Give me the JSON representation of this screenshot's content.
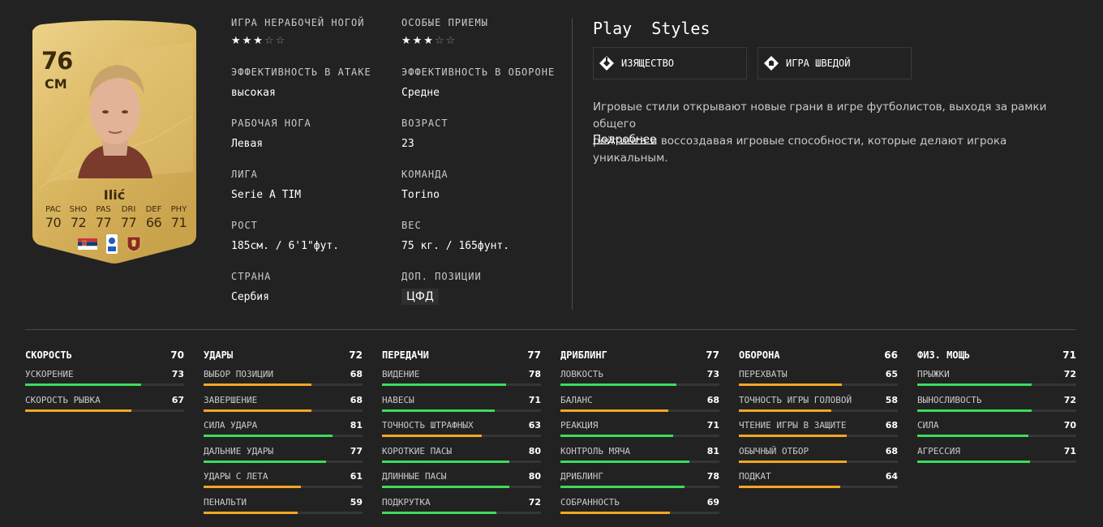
{
  "card": {
    "rating": "76",
    "position": "CM",
    "name": "Ilić",
    "stats": [
      {
        "label": "PAC",
        "value": "70"
      },
      {
        "label": "SHO",
        "value": "72"
      },
      {
        "label": "PAS",
        "value": "77"
      },
      {
        "label": "DRI",
        "value": "77"
      },
      {
        "label": "DEF",
        "value": "66"
      },
      {
        "label": "PHY",
        "value": "71"
      }
    ]
  },
  "info": {
    "weak_foot": {
      "label": "ИГРА НЕРАБОЧЕЙ НОГОЙ",
      "stars": 3
    },
    "skill_moves": {
      "label": "ОСОБЫЕ ПРИЕМЫ",
      "stars": 3
    },
    "attack_wr": {
      "label": "ЭФФЕКТИВНОСТЬ В АТАКЕ",
      "value": "высокая"
    },
    "defense_wr": {
      "label": "ЭФФЕКТИВНОСТЬ В ОБОРОНЕ",
      "value": "Средне"
    },
    "foot": {
      "label": "РАБОЧАЯ НОГА",
      "value": "Левая"
    },
    "age": {
      "label": "ВОЗРАСТ",
      "value": "23"
    },
    "league": {
      "label": "ЛИГА",
      "value": "Serie A TIM"
    },
    "team": {
      "label": "КОМАНДА",
      "value": "Torino"
    },
    "height": {
      "label": "РОСТ",
      "value": "185см. / 6'1\"фут."
    },
    "weight": {
      "label": "ВЕС",
      "value": "75 кг. / 165фунт."
    },
    "country": {
      "label": "СТРАНА",
      "value": "Сербия"
    },
    "alt_pos": {
      "label": "ДОП. ПОЗИЦИИ",
      "value": "ЦФД"
    }
  },
  "playstyles": {
    "title": "Play  Styles",
    "items": [
      "ИЗЯЩЕСТВО",
      "ИГРА ШВЕДОЙ"
    ],
    "description_line1": "Игровые стили открывают новые грани в игре футболистов, выходя за рамки общего",
    "description_line2": "рейтинга и воссоздавая игровые способности, которые делают игрока уникальным.",
    "more": "Подробнее"
  },
  "colors": {
    "good": "#3ddc5b",
    "mid": "#f5a623",
    "accent_gold": "#e0c068"
  },
  "groups": [
    {
      "title": "СКОРОСТЬ",
      "value": "70",
      "attrs": [
        {
          "name": "УСКОРЕНИЕ",
          "value": 73
        },
        {
          "name": "СКОРОСТЬ РЫВКА",
          "value": 67
        }
      ]
    },
    {
      "title": "УДАРЫ",
      "value": "72",
      "attrs": [
        {
          "name": "ВЫБОР ПОЗИЦИИ",
          "value": 68
        },
        {
          "name": "ЗАВЕРШЕНИЕ",
          "value": 68
        },
        {
          "name": "СИЛА УДАРА",
          "value": 81
        },
        {
          "name": "ДАЛЬНИЕ УДАРЫ",
          "value": 77
        },
        {
          "name": "УДАРЫ С ЛЕТА",
          "value": 61
        },
        {
          "name": "ПЕНАЛЬТИ",
          "value": 59
        }
      ]
    },
    {
      "title": "ПЕРЕДАЧИ",
      "value": "77",
      "attrs": [
        {
          "name": "ВИДЕНИЕ",
          "value": 78
        },
        {
          "name": "НАВЕСЫ",
          "value": 71
        },
        {
          "name": "ТОЧНОСТЬ ШТРАФНЫХ",
          "value": 63
        },
        {
          "name": "КОРОТКИЕ ПАСЫ",
          "value": 80
        },
        {
          "name": "ДЛИННЫЕ ПАСЫ",
          "value": 80
        },
        {
          "name": "ПОДКРУТКА",
          "value": 72
        }
      ]
    },
    {
      "title": "ДРИБЛИНГ",
      "value": "77",
      "attrs": [
        {
          "name": "ЛОВКОСТЬ",
          "value": 73
        },
        {
          "name": "БАЛАНС",
          "value": 68
        },
        {
          "name": "РЕАКЦИЯ",
          "value": 71
        },
        {
          "name": "КОНТРОЛЬ МЯЧА",
          "value": 81
        },
        {
          "name": "ДРИБЛИНГ",
          "value": 78
        },
        {
          "name": "СОБРАННОСТЬ",
          "value": 69
        }
      ]
    },
    {
      "title": "ОБОРОНА",
      "value": "66",
      "attrs": [
        {
          "name": "ПЕРЕХВАТЫ",
          "value": 65
        },
        {
          "name": "ТОЧНОСТЬ ИГРЫ ГОЛОВОЙ",
          "value": 58
        },
        {
          "name": "ЧТЕНИЕ ИГРЫ В ЗАЩИТЕ",
          "value": 68
        },
        {
          "name": "ОБЫЧНЫЙ ОТБОР",
          "value": 68
        },
        {
          "name": "ПОДКАТ",
          "value": 64
        }
      ]
    },
    {
      "title": "ФИЗ. МОЩЬ",
      "value": "71",
      "attrs": [
        {
          "name": "ПРЫЖКИ",
          "value": 72
        },
        {
          "name": "ВЫНОСЛИВОСТЬ",
          "value": 72
        },
        {
          "name": "СИЛА",
          "value": 70
        },
        {
          "name": "АГРЕССИЯ",
          "value": 71
        }
      ]
    }
  ]
}
